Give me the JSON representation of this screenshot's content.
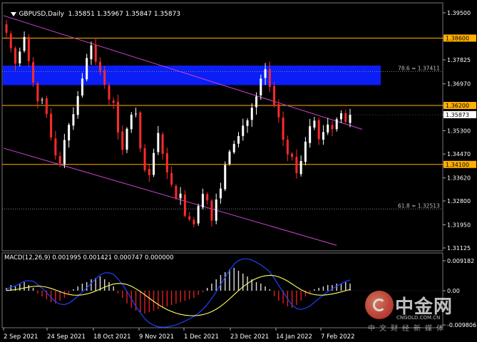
{
  "chart": {
    "symbol_line": "GBPUSD,Daily  1.35851 1.35967 1.35847 1.35873",
    "macd_line": "MACD(12,26,9) 0.001995 0.001421 0.000747 0.000000"
  },
  "price_scale": {
    "ticks": [
      "1.39500",
      "1.38600",
      "1.37825",
      "1.36970",
      "1.36200",
      "1.35873",
      "1.35300",
      "1.34470",
      "1.34100",
      "1.33620",
      "1.32800",
      "1.31950",
      "1.31125"
    ],
    "highlighted": [
      "1.38600",
      "1.36200",
      "1.34100"
    ],
    "current": "1.35873"
  },
  "levels": {
    "fib_786": "78.6 = 1.37411",
    "fib_618": "61.8 = 1.32513"
  },
  "macd_scale": {
    "ticks": [
      "0.009182",
      "0.00",
      "-0.009806"
    ]
  },
  "time_axis": {
    "labels": [
      "2 Sep 2021",
      "24 Sep 2021",
      "18 Oct 2021",
      "9 Nov 2021",
      "1 Dec 2021",
      "23 Dec 2021",
      "14 Jan 2022",
      "7 Feb 2022"
    ]
  },
  "watermark": {
    "brand": "中金网",
    "url": "CNGOLD.COM.CN",
    "tagline": "中文财经新媒体"
  },
  "colors": {
    "bull": "#ffffff",
    "bear": "#ff2a2a",
    "level_line": "#ffb000",
    "channel": "#cc44cc",
    "zone": "#0a1ef5",
    "macd_main": "#2040ff",
    "macd_signal": "#ffff66",
    "grid": "#555555"
  },
  "chart_data": {
    "type": "candlestick",
    "ohlc_points": [
      1.3879,
      1.3824,
      1.3769,
      1.3812,
      1.3864,
      1.3778,
      1.3702,
      1.3635,
      1.3641,
      1.359,
      1.3506,
      1.3442,
      1.3413,
      1.3497,
      1.3551,
      1.3589,
      1.3653,
      1.3716,
      1.3789,
      1.3834,
      1.3776,
      1.3742,
      1.3694,
      1.3641,
      1.3629,
      1.3524,
      1.3462,
      1.3537,
      1.3587,
      1.3591,
      1.3467,
      1.3389,
      1.3372,
      1.3451,
      1.3522,
      1.3448,
      1.3382,
      1.3338,
      1.3289,
      1.3306,
      1.3227,
      1.3214,
      1.3197,
      1.3262,
      1.3305,
      1.3282,
      1.321,
      1.3285,
      1.3324,
      1.3408,
      1.3456,
      1.3483,
      1.3511,
      1.3548,
      1.3567,
      1.3612,
      1.3652,
      1.3716,
      1.3749,
      1.3686,
      1.362,
      1.3578,
      1.3498,
      1.3446,
      1.3437,
      1.3379,
      1.3422,
      1.3491,
      1.3546,
      1.3566,
      1.35,
      1.3525,
      1.3552,
      1.3535,
      1.3571,
      1.3592,
      1.3562,
      1.3587
    ],
    "ylim": [
      1.31125,
      1.395
    ],
    "horizontal_levels": [
      1.386,
      1.362,
      1.341
    ],
    "fib_levels": [
      {
        "label": "78.6",
        "value": 1.37411
      },
      {
        "label": "61.8",
        "value": 1.32513
      }
    ],
    "zone": [
      1.3728,
      1.3752
    ],
    "macd": {
      "params": "12,26,9",
      "values": [
        0.001995,
        0.001421,
        0.000747,
        0.0
      ],
      "ylim": [
        -0.009806,
        0.009182
      ]
    }
  }
}
